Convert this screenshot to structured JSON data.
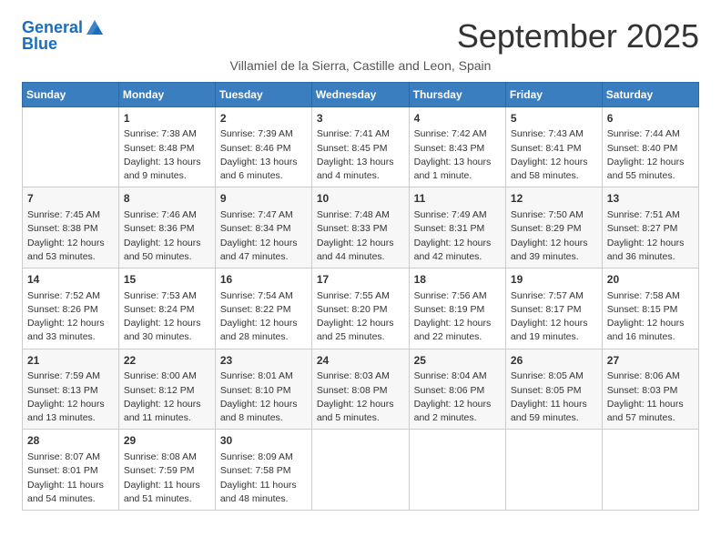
{
  "header": {
    "logo_line1": "General",
    "logo_line2": "Blue",
    "month": "September 2025",
    "location": "Villamiel de la Sierra, Castille and Leon, Spain"
  },
  "days_of_week": [
    "Sunday",
    "Monday",
    "Tuesday",
    "Wednesday",
    "Thursday",
    "Friday",
    "Saturday"
  ],
  "weeks": [
    [
      {
        "num": "",
        "sunrise": "",
        "sunset": "",
        "daylight": ""
      },
      {
        "num": "1",
        "sunrise": "Sunrise: 7:38 AM",
        "sunset": "Sunset: 8:48 PM",
        "daylight": "Daylight: 13 hours and 9 minutes."
      },
      {
        "num": "2",
        "sunrise": "Sunrise: 7:39 AM",
        "sunset": "Sunset: 8:46 PM",
        "daylight": "Daylight: 13 hours and 6 minutes."
      },
      {
        "num": "3",
        "sunrise": "Sunrise: 7:41 AM",
        "sunset": "Sunset: 8:45 PM",
        "daylight": "Daylight: 13 hours and 4 minutes."
      },
      {
        "num": "4",
        "sunrise": "Sunrise: 7:42 AM",
        "sunset": "Sunset: 8:43 PM",
        "daylight": "Daylight: 13 hours and 1 minute."
      },
      {
        "num": "5",
        "sunrise": "Sunrise: 7:43 AM",
        "sunset": "Sunset: 8:41 PM",
        "daylight": "Daylight: 12 hours and 58 minutes."
      },
      {
        "num": "6",
        "sunrise": "Sunrise: 7:44 AM",
        "sunset": "Sunset: 8:40 PM",
        "daylight": "Daylight: 12 hours and 55 minutes."
      }
    ],
    [
      {
        "num": "7",
        "sunrise": "Sunrise: 7:45 AM",
        "sunset": "Sunset: 8:38 PM",
        "daylight": "Daylight: 12 hours and 53 minutes."
      },
      {
        "num": "8",
        "sunrise": "Sunrise: 7:46 AM",
        "sunset": "Sunset: 8:36 PM",
        "daylight": "Daylight: 12 hours and 50 minutes."
      },
      {
        "num": "9",
        "sunrise": "Sunrise: 7:47 AM",
        "sunset": "Sunset: 8:34 PM",
        "daylight": "Daylight: 12 hours and 47 minutes."
      },
      {
        "num": "10",
        "sunrise": "Sunrise: 7:48 AM",
        "sunset": "Sunset: 8:33 PM",
        "daylight": "Daylight: 12 hours and 44 minutes."
      },
      {
        "num": "11",
        "sunrise": "Sunrise: 7:49 AM",
        "sunset": "Sunset: 8:31 PM",
        "daylight": "Daylight: 12 hours and 42 minutes."
      },
      {
        "num": "12",
        "sunrise": "Sunrise: 7:50 AM",
        "sunset": "Sunset: 8:29 PM",
        "daylight": "Daylight: 12 hours and 39 minutes."
      },
      {
        "num": "13",
        "sunrise": "Sunrise: 7:51 AM",
        "sunset": "Sunset: 8:27 PM",
        "daylight": "Daylight: 12 hours and 36 minutes."
      }
    ],
    [
      {
        "num": "14",
        "sunrise": "Sunrise: 7:52 AM",
        "sunset": "Sunset: 8:26 PM",
        "daylight": "Daylight: 12 hours and 33 minutes."
      },
      {
        "num": "15",
        "sunrise": "Sunrise: 7:53 AM",
        "sunset": "Sunset: 8:24 PM",
        "daylight": "Daylight: 12 hours and 30 minutes."
      },
      {
        "num": "16",
        "sunrise": "Sunrise: 7:54 AM",
        "sunset": "Sunset: 8:22 PM",
        "daylight": "Daylight: 12 hours and 28 minutes."
      },
      {
        "num": "17",
        "sunrise": "Sunrise: 7:55 AM",
        "sunset": "Sunset: 8:20 PM",
        "daylight": "Daylight: 12 hours and 25 minutes."
      },
      {
        "num": "18",
        "sunrise": "Sunrise: 7:56 AM",
        "sunset": "Sunset: 8:19 PM",
        "daylight": "Daylight: 12 hours and 22 minutes."
      },
      {
        "num": "19",
        "sunrise": "Sunrise: 7:57 AM",
        "sunset": "Sunset: 8:17 PM",
        "daylight": "Daylight: 12 hours and 19 minutes."
      },
      {
        "num": "20",
        "sunrise": "Sunrise: 7:58 AM",
        "sunset": "Sunset: 8:15 PM",
        "daylight": "Daylight: 12 hours and 16 minutes."
      }
    ],
    [
      {
        "num": "21",
        "sunrise": "Sunrise: 7:59 AM",
        "sunset": "Sunset: 8:13 PM",
        "daylight": "Daylight: 12 hours and 13 minutes."
      },
      {
        "num": "22",
        "sunrise": "Sunrise: 8:00 AM",
        "sunset": "Sunset: 8:12 PM",
        "daylight": "Daylight: 12 hours and 11 minutes."
      },
      {
        "num": "23",
        "sunrise": "Sunrise: 8:01 AM",
        "sunset": "Sunset: 8:10 PM",
        "daylight": "Daylight: 12 hours and 8 minutes."
      },
      {
        "num": "24",
        "sunrise": "Sunrise: 8:03 AM",
        "sunset": "Sunset: 8:08 PM",
        "daylight": "Daylight: 12 hours and 5 minutes."
      },
      {
        "num": "25",
        "sunrise": "Sunrise: 8:04 AM",
        "sunset": "Sunset: 8:06 PM",
        "daylight": "Daylight: 12 hours and 2 minutes."
      },
      {
        "num": "26",
        "sunrise": "Sunrise: 8:05 AM",
        "sunset": "Sunset: 8:05 PM",
        "daylight": "Daylight: 11 hours and 59 minutes."
      },
      {
        "num": "27",
        "sunrise": "Sunrise: 8:06 AM",
        "sunset": "Sunset: 8:03 PM",
        "daylight": "Daylight: 11 hours and 57 minutes."
      }
    ],
    [
      {
        "num": "28",
        "sunrise": "Sunrise: 8:07 AM",
        "sunset": "Sunset: 8:01 PM",
        "daylight": "Daylight: 11 hours and 54 minutes."
      },
      {
        "num": "29",
        "sunrise": "Sunrise: 8:08 AM",
        "sunset": "Sunset: 7:59 PM",
        "daylight": "Daylight: 11 hours and 51 minutes."
      },
      {
        "num": "30",
        "sunrise": "Sunrise: 8:09 AM",
        "sunset": "Sunset: 7:58 PM",
        "daylight": "Daylight: 11 hours and 48 minutes."
      },
      {
        "num": "",
        "sunrise": "",
        "sunset": "",
        "daylight": ""
      },
      {
        "num": "",
        "sunrise": "",
        "sunset": "",
        "daylight": ""
      },
      {
        "num": "",
        "sunrise": "",
        "sunset": "",
        "daylight": ""
      },
      {
        "num": "",
        "sunrise": "",
        "sunset": "",
        "daylight": ""
      }
    ]
  ]
}
